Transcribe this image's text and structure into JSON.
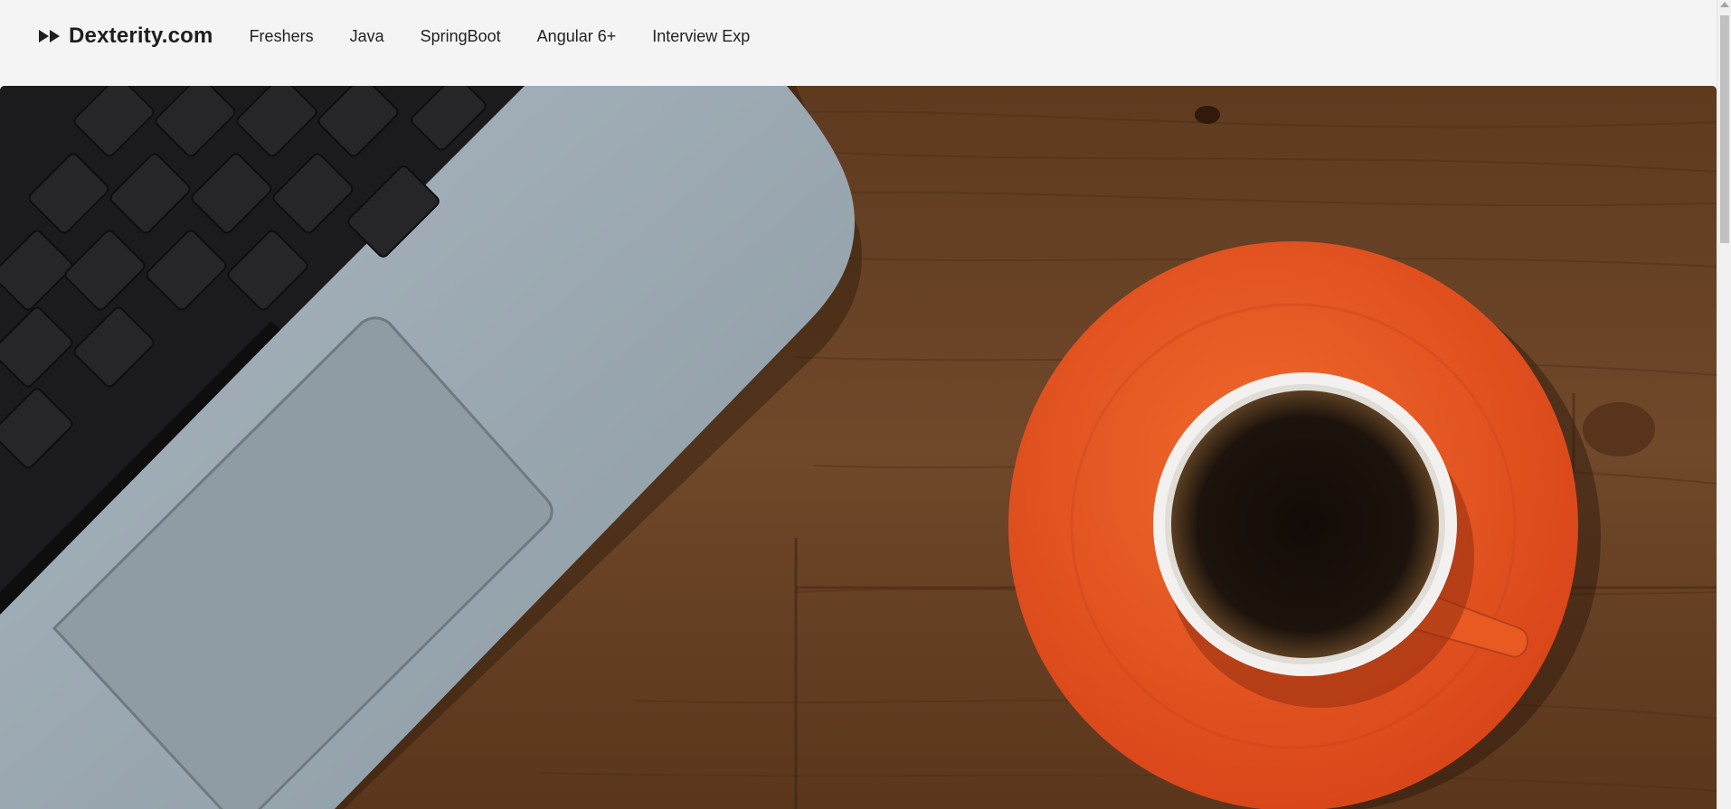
{
  "brand": {
    "icon": "fast-forward-icon",
    "name": "Dexterity.com"
  },
  "nav": {
    "items": [
      {
        "label": "Freshers"
      },
      {
        "label": "Java"
      },
      {
        "label": "SpringBoot"
      },
      {
        "label": "Angular 6+"
      },
      {
        "label": "Interview Exp"
      }
    ]
  },
  "hero": {
    "description_icon": "laptop-and-coffee-cup-hero-image",
    "colors": {
      "wood": "#6b4423",
      "laptop": "#9aa6ae",
      "saucer": "#e8531f",
      "coffee": "#1a120c"
    }
  },
  "theme": {
    "nav_bg": "#f4f4f4",
    "text": "#1e1e1e"
  }
}
